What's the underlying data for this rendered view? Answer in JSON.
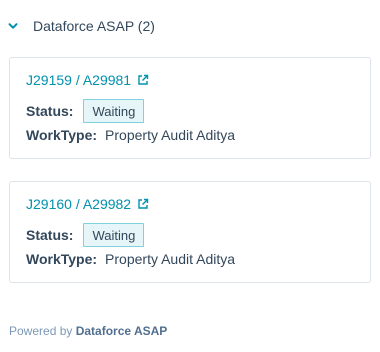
{
  "section": {
    "title": "Dataforce ASAP (2)",
    "expanded_icon": "chevron-down-icon"
  },
  "cards": [
    {
      "link": "J29159 / A29981",
      "status_label": "Status:",
      "status_value": "Waiting",
      "worktype_label": "WorkType:",
      "worktype_value": "Property Audit Aditya"
    },
    {
      "link": "J29160 / A29982",
      "status_label": "Status:",
      "status_value": "Waiting",
      "worktype_label": "WorkType:",
      "worktype_value": "Property Audit Aditya"
    }
  ],
  "footer": {
    "prefix": "Powered by",
    "brand": "Dataforce ASAP"
  },
  "colors": {
    "link": "#0091ae",
    "badge_bg": "#e5f5f8",
    "badge_border": "#7fd1de",
    "text": "#33475b"
  }
}
